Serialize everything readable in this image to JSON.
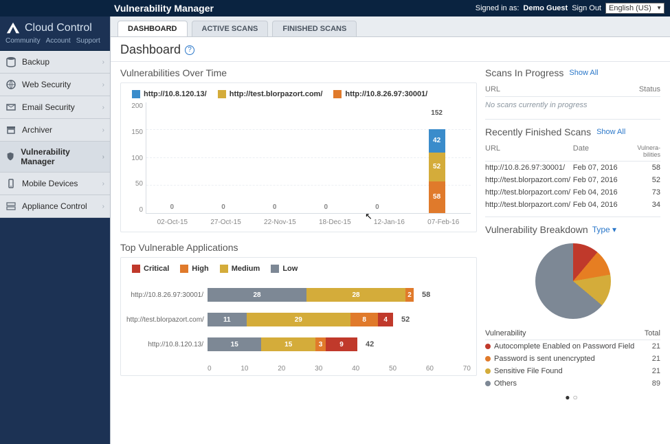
{
  "topbar": {
    "app_title": "Vulnerability Manager",
    "signed_in_prefix": "Signed in as:",
    "user": "Demo Guest",
    "sign_out": "Sign Out",
    "language": "English (US)"
  },
  "brand": {
    "name": "Cloud Control",
    "links": [
      "Community",
      "Account",
      "Support"
    ]
  },
  "sidebar": {
    "items": [
      {
        "label": "Backup"
      },
      {
        "label": "Web Security"
      },
      {
        "label": "Email Security"
      },
      {
        "label": "Archiver"
      },
      {
        "label": "Vulnerability Manager",
        "active": true
      },
      {
        "label": "Mobile Devices"
      },
      {
        "label": "Appliance Control"
      }
    ]
  },
  "tabs": [
    {
      "label": "DASHBOARD",
      "active": true
    },
    {
      "label": "ACTIVE SCANS"
    },
    {
      "label": "FINISHED SCANS"
    }
  ],
  "page": {
    "title": "Dashboard"
  },
  "vot": {
    "title": "Vulnerabilities Over Time",
    "series_names": [
      "http://10.8.120.13/",
      "http://test.blorpazort.com/",
      "http://10.8.26.97:30001/"
    ],
    "categories": [
      "02-Oct-15",
      "27-Oct-15",
      "22-Nov-15",
      "18-Dec-15",
      "12-Jan-16",
      "07-Feb-16"
    ],
    "y_ticks": [
      "0",
      "50",
      "100",
      "150",
      "200"
    ],
    "data_point_total": "152",
    "segs": {
      "blue": "42",
      "mustard": "52",
      "orange": "58"
    },
    "zeros": [
      "0",
      "0",
      "0",
      "0",
      "0"
    ]
  },
  "chart_data": [
    {
      "type": "bar",
      "title": "Vulnerabilities Over Time",
      "stacked": true,
      "categories": [
        "02-Oct-15",
        "27-Oct-15",
        "22-Nov-15",
        "18-Dec-15",
        "12-Jan-16",
        "07-Feb-16"
      ],
      "series": [
        {
          "name": "http://10.8.120.13/",
          "values": [
            0,
            0,
            0,
            0,
            0,
            42
          ],
          "color": "#3a8ccb"
        },
        {
          "name": "http://test.blorpazort.com/",
          "values": [
            0,
            0,
            0,
            0,
            0,
            52
          ],
          "color": "#d4ac3a"
        },
        {
          "name": "http://10.8.26.97:30001/",
          "values": [
            0,
            0,
            0,
            0,
            0,
            58
          ],
          "color": "#e07a2b"
        }
      ],
      "ylim": [
        0,
        200
      ],
      "ylabel": "",
      "xlabel": ""
    },
    {
      "type": "bar",
      "title": "Top Vulnerable Applications",
      "orientation": "horizontal",
      "stacked": true,
      "categories": [
        "http://10.8.26.97:30001/",
        "http://test.blorpazort.com/",
        "http://10.8.120.13/"
      ],
      "series": [
        {
          "name": "Critical",
          "values": [
            0,
            4,
            9
          ],
          "color": "#c0392b"
        },
        {
          "name": "High",
          "values": [
            2,
            8,
            3
          ],
          "color": "#e07a2b"
        },
        {
          "name": "Medium",
          "values": [
            28,
            29,
            15
          ],
          "color": "#d4ac3a"
        },
        {
          "name": "Low",
          "values": [
            28,
            11,
            15
          ],
          "color": "#7d8895"
        }
      ],
      "totals": [
        58,
        52,
        42
      ],
      "xlim": [
        0,
        70
      ]
    },
    {
      "type": "pie",
      "title": "Vulnerability Breakdown",
      "breakdown_by": "Type",
      "slices": [
        {
          "name": "Autocomplete Enabled on Password Field",
          "value": 21,
          "color": "#c0392b"
        },
        {
          "name": "Password is sent unencrypted",
          "value": 21,
          "color": "#e07a2b"
        },
        {
          "name": "Sensitive File Found",
          "value": 21,
          "color": "#d4ac3a"
        },
        {
          "name": "Others",
          "value": 89,
          "color": "#7d8895"
        }
      ]
    }
  ],
  "tva": {
    "title": "Top Vulnerable Applications",
    "legend": [
      "Critical",
      "High",
      "Medium",
      "Low"
    ],
    "rows": [
      {
        "label": "http://10.8.26.97:30001/",
        "low": "28",
        "medium": "28",
        "high": "2",
        "critical": "",
        "total": "58"
      },
      {
        "label": "http://test.blorpazort.com/",
        "low": "11",
        "medium": "29",
        "high": "8",
        "critical": "4",
        "total": "52"
      },
      {
        "label": "http://10.8.120.13/",
        "low": "15",
        "medium": "15",
        "high": "3",
        "critical": "9",
        "total": "42"
      }
    ],
    "x_ticks": [
      "0",
      "10",
      "20",
      "30",
      "40",
      "50",
      "60",
      "70"
    ]
  },
  "scans_in_progress": {
    "title": "Scans In Progress",
    "show_all": "Show All",
    "head_url": "URL",
    "head_status": "Status",
    "empty": "No scans currently in progress"
  },
  "recent": {
    "title": "Recently Finished Scans",
    "show_all": "Show All",
    "head_url": "URL",
    "head_date": "Date",
    "head_vuln": "Vulnera-\nbilities",
    "rows": [
      {
        "url": "http://10.8.26.97:30001/",
        "date": "Feb 07, 2016",
        "vuln": "58"
      },
      {
        "url": "http://test.blorpazort.com/",
        "date": "Feb 07, 2016",
        "vuln": "52"
      },
      {
        "url": "http://test.blorpazort.com/",
        "date": "Feb 04, 2016",
        "vuln": "73"
      },
      {
        "url": "http://test.blorpazort.com/",
        "date": "Feb 04, 2016",
        "vuln": "34"
      }
    ]
  },
  "vb": {
    "title": "Vulnerability Breakdown",
    "type_label": "Type",
    "head_vuln": "Vulnerability",
    "head_total": "Total",
    "rows": [
      {
        "color": "#c0392b",
        "name": "Autocomplete Enabled on Password Field",
        "total": "21"
      },
      {
        "color": "#e07a2b",
        "name": "Password is sent unencrypted",
        "total": "21"
      },
      {
        "color": "#d4ac3a",
        "name": "Sensitive File Found",
        "total": "21"
      },
      {
        "color": "#7d8895",
        "name": "Others",
        "total": "89"
      }
    ]
  }
}
